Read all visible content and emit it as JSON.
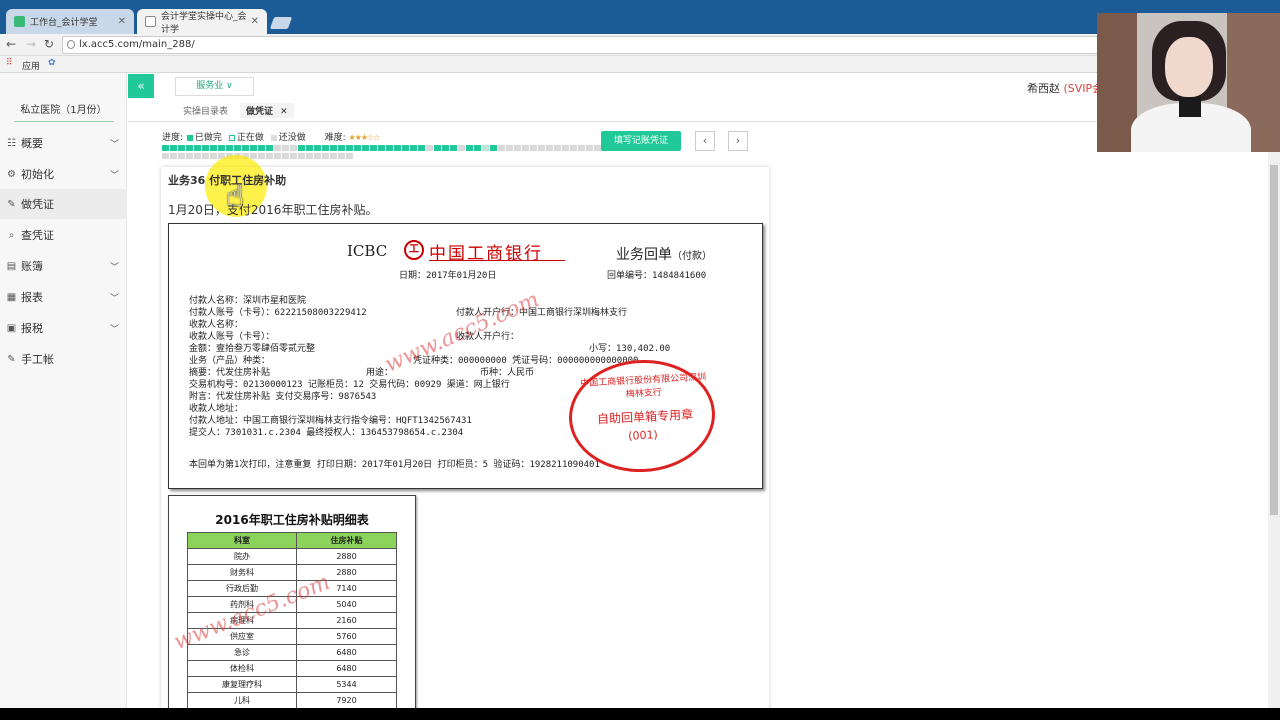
{
  "browser": {
    "tabs": [
      {
        "title": "工作台_会计学堂"
      },
      {
        "title": "会计学堂实操中心_会计学"
      }
    ],
    "url": "lx.acc5.com/main_288/",
    "bookmarks_label": "应用"
  },
  "sidebar": {
    "title": "私立医院（1月份）",
    "items": [
      {
        "label": "概要",
        "icon": "list-icon"
      },
      {
        "label": "初始化",
        "icon": "gear-icon"
      },
      {
        "label": "做凭证",
        "icon": "pen-icon"
      },
      {
        "label": "查凭证",
        "icon": "search-icon"
      },
      {
        "label": "账簿",
        "icon": "book-icon"
      },
      {
        "label": "报表",
        "icon": "report-icon"
      },
      {
        "label": "报税",
        "icon": "tax-icon"
      },
      {
        "label": "手工帐",
        "icon": "pen-icon"
      }
    ]
  },
  "header": {
    "service": "服务业",
    "user": "希西赵",
    "svip": "(SVIP会"
  },
  "subtabs": [
    "实操目录表",
    "做凭证"
  ],
  "progress": {
    "label": "进度:",
    "done": "已做完",
    "doing": "正在做",
    "todo": "还没做",
    "difficulty_label": "难度:",
    "difficulty_stars": "★★★☆☆",
    "record_button": "填写记账凭证"
  },
  "task": {
    "title": "业务36 付职工住房补助",
    "desc": "1月20日，支付2016年职工住房补贴。"
  },
  "receipt": {
    "icbc": "ICBC",
    "bank_name": "中国工商银行",
    "title": "业务回单",
    "title_small": "（付款）",
    "date": "日期：2017年01月20日",
    "receipt_no": "回单编号：1484841600",
    "lines": [
      "付款人名称：深圳市星和医院",
      "付款人账号（卡号）：6222150800322941​2",
      "收款人名称：",
      "收款人账号（卡号）：",
      "金额：壹拾叁万零肆佰零贰元整",
      "业务（产品）种类：",
      "摘要：代发住房补贴",
      "交易机构号：02130000123    记账柜员：12    交易代码：00929    渠道：网上银行",
      "附言：代发住房补贴    支付交易序号：9876543",
      "收款人地址：",
      "付款人地址：中国工商银行深圳梅林支行指令编号：HQFT1342567431",
      "提交人：7301031.c.2304 最终授权人：136453798654.c.2304"
    ],
    "payer_bank": "付款人开户行：中国工商银行深圳梅林支行",
    "payee_bank": "收款人开户行：",
    "amount_small": "小写：130,402.00",
    "voucher": "凭证种类：000000000 凭证号码：000000000000000",
    "usage": "用途：",
    "currency": "币种：人民币",
    "footer": "本回单为第1次打印，注意重复  打印日期：2017年01月20日  打印柜员：5  验证码：1928211090401",
    "stamp_ring": "中国工商银行股份有限公司深圳梅林支行",
    "stamp_main": "自助回单箱专用章",
    "stamp_num": "(001)"
  },
  "subsidy": {
    "title": "2016年职工住房补贴明细表",
    "headers": [
      "科室",
      "住房补贴"
    ],
    "rows": [
      [
        "院办",
        "2880"
      ],
      [
        "财务科",
        "2880"
      ],
      [
        "行政后勤",
        "7140"
      ],
      [
        "药剂科",
        "5040"
      ],
      [
        "病理科",
        "2160"
      ],
      [
        "供应室",
        "5760"
      ],
      [
        "急诊",
        "6480"
      ],
      [
        "体检科",
        "6480"
      ],
      [
        "康复理疗科",
        "5344"
      ],
      [
        "儿科",
        "7920"
      ]
    ]
  },
  "watermark": "www.acc5.com",
  "colors": {
    "accent": "#20c997",
    "done": "#20c997",
    "doing": "#b9e6d6",
    "todo": "#d9d9d9",
    "stamp": "#d22222"
  }
}
